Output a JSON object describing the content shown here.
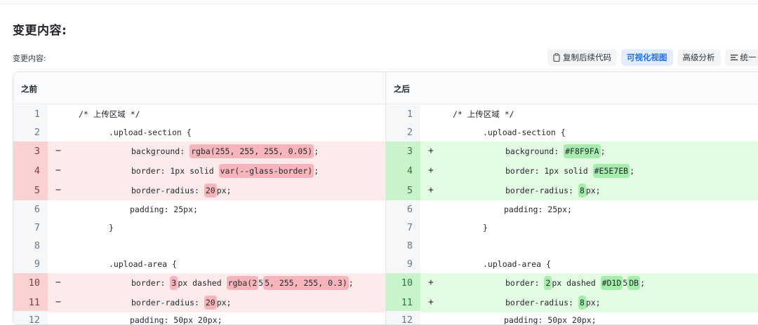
{
  "page": {
    "title": "变更内容:",
    "section_label": "变更内容:"
  },
  "toolbar": {
    "copy_label": "复制后续代码",
    "visual_label": "可视化视图",
    "advanced_label": "高级分析",
    "unified_label": "统一"
  },
  "icons": {
    "copy": "clipboard-icon",
    "unified": "lines-icon"
  },
  "colors": {
    "accent": "#1f6feb",
    "deleted_bg": "#fdeaea",
    "deleted_highlight": "#f8b4bb",
    "added_bg": "#e3fbe3",
    "added_highlight": "#a6ecac"
  },
  "diff": {
    "before_label": "之前",
    "after_label": "之后",
    "before": [
      {
        "n": "1",
        "type": "ctx",
        "mark": "",
        "segs": [
          {
            "t": "/* 上传区域 */",
            "h": false
          }
        ]
      },
      {
        "n": "2",
        "type": "ctx",
        "mark": "",
        "segs": [
          {
            "t": ".upload-section {",
            "h": false
          }
        ]
      },
      {
        "n": "3",
        "type": "del",
        "mark": "−",
        "segs": [
          {
            "t": "background: ",
            "h": false
          },
          {
            "t": "rgba(255, 255, 255, 0.05)",
            "h": true
          },
          {
            "t": ";",
            "h": false
          }
        ]
      },
      {
        "n": "4",
        "type": "del",
        "mark": "−",
        "segs": [
          {
            "t": "border: 1px solid ",
            "h": false
          },
          {
            "t": "var(--glass-border)",
            "h": true
          },
          {
            "t": ";",
            "h": false
          }
        ]
      },
      {
        "n": "5",
        "type": "del",
        "mark": "−",
        "segs": [
          {
            "t": "border-radius: ",
            "h": false
          },
          {
            "t": "20",
            "h": true
          },
          {
            "t": "px;",
            "h": false
          }
        ]
      },
      {
        "n": "6",
        "type": "ctx",
        "mark": "",
        "segs": [
          {
            "t": "padding: 25px;",
            "h": false
          }
        ]
      },
      {
        "n": "7",
        "type": "ctx",
        "mark": "",
        "segs": [
          {
            "t": "}",
            "h": false
          }
        ]
      },
      {
        "n": "8",
        "type": "ctx",
        "mark": "",
        "segs": []
      },
      {
        "n": "9",
        "type": "ctx",
        "mark": "",
        "segs": [
          {
            "t": ".upload-area {",
            "h": false
          }
        ]
      },
      {
        "n": "10",
        "type": "del",
        "mark": "−",
        "segs": [
          {
            "t": "border: ",
            "h": false
          },
          {
            "t": "3",
            "h": true
          },
          {
            "t": "px dashed ",
            "h": false
          },
          {
            "t": "rgba(2",
            "h": true
          },
          {
            "t": "5",
            "h": false
          },
          {
            "t": "5, 255, 255, 0.3)",
            "h": true
          },
          {
            "t": ";",
            "h": false
          }
        ]
      },
      {
        "n": "11",
        "type": "del",
        "mark": "−",
        "segs": [
          {
            "t": "border-radius: ",
            "h": false
          },
          {
            "t": "20",
            "h": true
          },
          {
            "t": "px;",
            "h": false
          }
        ]
      },
      {
        "n": "12",
        "type": "ctx",
        "mark": "",
        "segs": [
          {
            "t": "padding: 50px 20px;",
            "h": false
          }
        ]
      }
    ],
    "after": [
      {
        "n": "1",
        "type": "ctx",
        "mark": "",
        "segs": [
          {
            "t": "/* 上传区域 */",
            "h": false
          }
        ]
      },
      {
        "n": "2",
        "type": "ctx",
        "mark": "",
        "segs": [
          {
            "t": ".upload-section {",
            "h": false
          }
        ]
      },
      {
        "n": "3",
        "type": "add",
        "mark": "+",
        "segs": [
          {
            "t": "background: ",
            "h": false
          },
          {
            "t": "#F8F9FA",
            "h": true
          },
          {
            "t": ";",
            "h": false
          }
        ]
      },
      {
        "n": "4",
        "type": "add",
        "mark": "+",
        "segs": [
          {
            "t": "border: 1px solid ",
            "h": false
          },
          {
            "t": "#E5E7EB",
            "h": true
          },
          {
            "t": ";",
            "h": false
          }
        ]
      },
      {
        "n": "5",
        "type": "add",
        "mark": "+",
        "segs": [
          {
            "t": "border-radius: ",
            "h": false
          },
          {
            "t": "8",
            "h": true
          },
          {
            "t": "px;",
            "h": false
          }
        ]
      },
      {
        "n": "6",
        "type": "ctx",
        "mark": "",
        "segs": [
          {
            "t": "padding: 25px;",
            "h": false
          }
        ]
      },
      {
        "n": "7",
        "type": "ctx",
        "mark": "",
        "segs": [
          {
            "t": "}",
            "h": false
          }
        ]
      },
      {
        "n": "8",
        "type": "ctx",
        "mark": "",
        "segs": []
      },
      {
        "n": "9",
        "type": "ctx",
        "mark": "",
        "segs": [
          {
            "t": ".upload-area {",
            "h": false
          }
        ]
      },
      {
        "n": "10",
        "type": "add",
        "mark": "+",
        "segs": [
          {
            "t": "border: ",
            "h": false
          },
          {
            "t": "2",
            "h": true
          },
          {
            "t": "px dashed ",
            "h": false
          },
          {
            "t": "#D1D",
            "h": true
          },
          {
            "t": "5",
            "h": false
          },
          {
            "t": "DB",
            "h": true
          },
          {
            "t": ";",
            "h": false
          }
        ]
      },
      {
        "n": "11",
        "type": "add",
        "mark": "+",
        "segs": [
          {
            "t": "border-radius: ",
            "h": false
          },
          {
            "t": "8",
            "h": true
          },
          {
            "t": "px;",
            "h": false
          }
        ]
      },
      {
        "n": "12",
        "type": "ctx",
        "mark": "",
        "segs": [
          {
            "t": "padding: 50px 20px;",
            "h": false
          }
        ]
      }
    ]
  }
}
